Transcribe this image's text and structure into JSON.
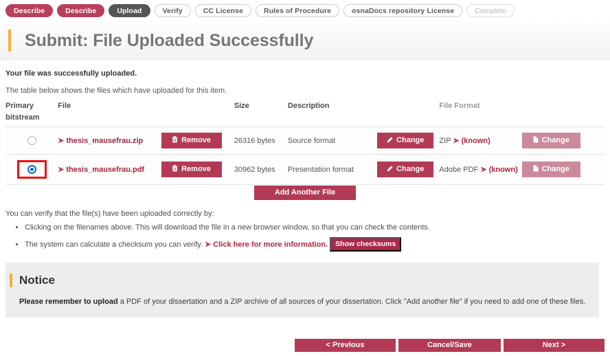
{
  "progress_tabs": [
    {
      "label": "Describe",
      "state": "done"
    },
    {
      "label": "Describe",
      "state": "done"
    },
    {
      "label": "Upload",
      "state": "current"
    },
    {
      "label": "Verify",
      "state": "todo"
    },
    {
      "label": "CC License",
      "state": "todo"
    },
    {
      "label": "Rules of Procedure",
      "state": "todo"
    },
    {
      "label": "osnaDocs repository License",
      "state": "todo"
    },
    {
      "label": "Complete",
      "state": "disabled"
    }
  ],
  "page": {
    "title": "Submit: File Uploaded Successfully",
    "lead": "Your file was successfully uploaded.",
    "sub": "The table below shows the files which have uploaded for this item."
  },
  "table": {
    "headers": {
      "primary_line1": "Primary",
      "primary_line2": "bitstream",
      "file": "File",
      "remove": "",
      "size": "Size",
      "description": "Description",
      "change1": "",
      "file_format": "File Format",
      "change2": ""
    },
    "rows": [
      {
        "primary_selected": false,
        "highlighted": false,
        "filename": "thesis_mausefrau.zip",
        "remove_label": "Remove",
        "size": "26316 bytes",
        "description": "Source format",
        "change_desc_label": "Change",
        "format_name": "ZIP",
        "format_status": "(known)",
        "change_format_label": "Change"
      },
      {
        "primary_selected": true,
        "highlighted": true,
        "filename": "thesis_mausefrau.pdf",
        "remove_label": "Remove",
        "size": "30962 bytes",
        "description": "Presentation format",
        "change_desc_label": "Change",
        "format_name": "Adobe PDF",
        "format_status": "(known)",
        "change_format_label": "Change"
      }
    ],
    "add_file_label": "Add Another File"
  },
  "verify": {
    "intro": "You can verify that the file(s) have been uploaded correctly by:",
    "bullet1": "Clicking on the filenames above. This will download the file in a new browser window, so that you can check the contents.",
    "bullet2_text": "The system can calculate a checksum you can verify.",
    "bullet2_link": "Click here for more information.",
    "show_checksums_label": "Show checksums"
  },
  "notice": {
    "title": "Notice",
    "bold_lead": "Please remember to upload",
    "body": " a PDF of your dissertation and a ZIP archive of all sources of your dissertation. Click \"Add another file\" if you need to add one of these files."
  },
  "nav": {
    "previous": "< Previous",
    "cancel_save": "Cancel/Save",
    "next": "Next >"
  },
  "colors": {
    "crimson": "#b23a55",
    "crimson_dark": "#a8294a",
    "faded_pink": "#cb8a9c",
    "accent_yellow": "#f2b134",
    "radio_blue": "#1569c7",
    "highlight_red": "#ee1111",
    "panel_gray": "#ededed"
  },
  "icons": {
    "trash": "trash-icon",
    "pencil": "pencil-icon",
    "document": "document-icon",
    "chevron": "chevron-right-icon"
  }
}
